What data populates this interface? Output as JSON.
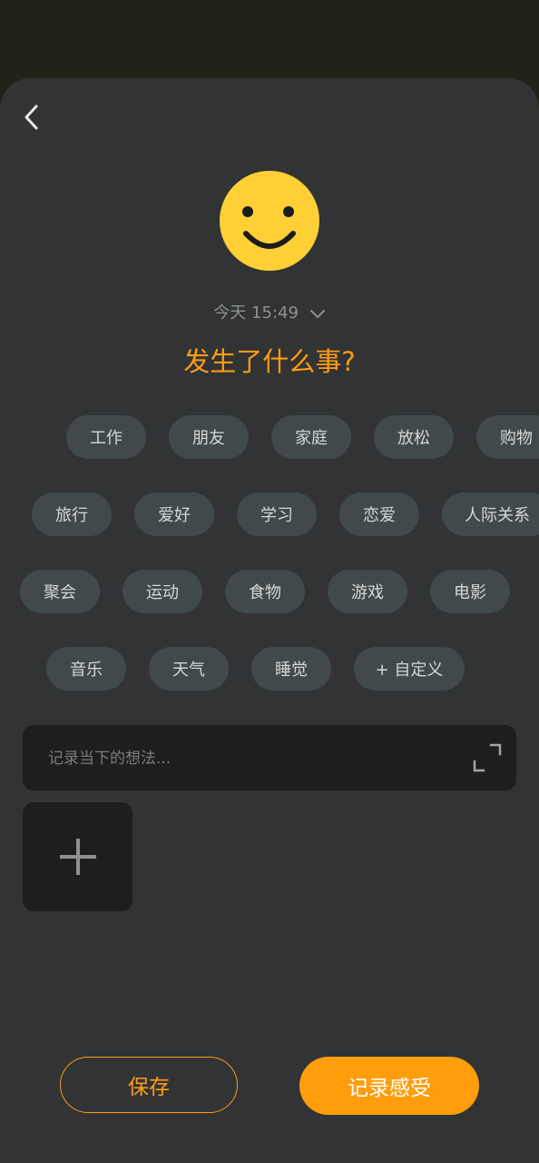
{
  "header": {
    "back_icon": "chevron-left-icon"
  },
  "mood": {
    "icon": "smiley-face-icon",
    "color": "#FFD036"
  },
  "date_selector": {
    "text": "今天 15:49",
    "icon": "chevron-down-icon"
  },
  "question": "发生了什么事?",
  "tag_rows": [
    [
      "工作",
      "朋友",
      "家庭",
      "放松",
      "购物"
    ],
    [
      "旅行",
      "爱好",
      "学习",
      "恋爱",
      "人际关系"
    ],
    [
      "聚会",
      "运动",
      "食物",
      "游戏",
      "电影"
    ],
    [
      "音乐",
      "天气",
      "睡觉",
      "+ 自定义"
    ]
  ],
  "note": {
    "placeholder": "记录当下的想法...",
    "expand_icon": "expand-icon"
  },
  "photo": {
    "add_icon": "plus-icon"
  },
  "actions": {
    "save_label": "保存",
    "record_label": "记录感受"
  },
  "colors": {
    "accent": "#FF9D14",
    "sheet_bg": "#313334",
    "tag_bg": "#41494A",
    "input_bg": "#1D1E1E",
    "top_bg": "#202418"
  }
}
